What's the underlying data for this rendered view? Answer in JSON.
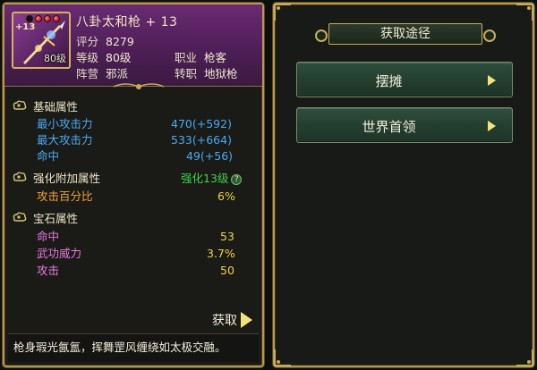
{
  "item": {
    "plus_badge": "+13",
    "slot_level": "80级",
    "name": "八卦太和枪 + 13",
    "info": [
      {
        "k": "评分",
        "v": "8279"
      },
      {
        "k": "等级",
        "v": "80级"
      },
      {
        "k": "职业",
        "v": "枪客"
      },
      {
        "k": "阵营",
        "v": "邪派"
      },
      {
        "k": "转职",
        "v": "地狱枪"
      }
    ],
    "gems": [
      "black",
      "red",
      "red",
      "red"
    ]
  },
  "base_attrs": {
    "title": "基础属性",
    "rows": [
      {
        "label": "最小攻击力",
        "value": "470(+592)"
      },
      {
        "label": "最大攻击力",
        "value": "533(+664)"
      },
      {
        "label": "命中",
        "value": "49(+56)"
      }
    ]
  },
  "enhance_attrs": {
    "title": "强化附加属性",
    "badge": "强化13级",
    "help": "?",
    "rows": [
      {
        "label": "攻击百分比",
        "value": "6%"
      }
    ]
  },
  "gem_attrs": {
    "title": "宝石属性",
    "rows": [
      {
        "label": "命中",
        "value": "53"
      },
      {
        "label": "武功威力",
        "value": "3.7%"
      },
      {
        "label": "攻击",
        "value": "50"
      }
    ]
  },
  "obtain_label": "获取",
  "description": "枪身瑕光氤氲，挥舞罡风缠绕如太极交融。",
  "sources": {
    "title": "获取途径",
    "buttons": [
      {
        "label": "摆摊"
      },
      {
        "label": "世界首领"
      }
    ]
  },
  "colors": {
    "frame_gold": "#b89a4e",
    "header_purple": "#5a2463",
    "attr_blue": "#4aa8f2",
    "attr_green": "#3fd24a",
    "attr_orange": "#f0a23c",
    "attr_pink": "#e978e0",
    "value_yellow": "#f2d14a",
    "button_green": "#2f4e3d"
  }
}
